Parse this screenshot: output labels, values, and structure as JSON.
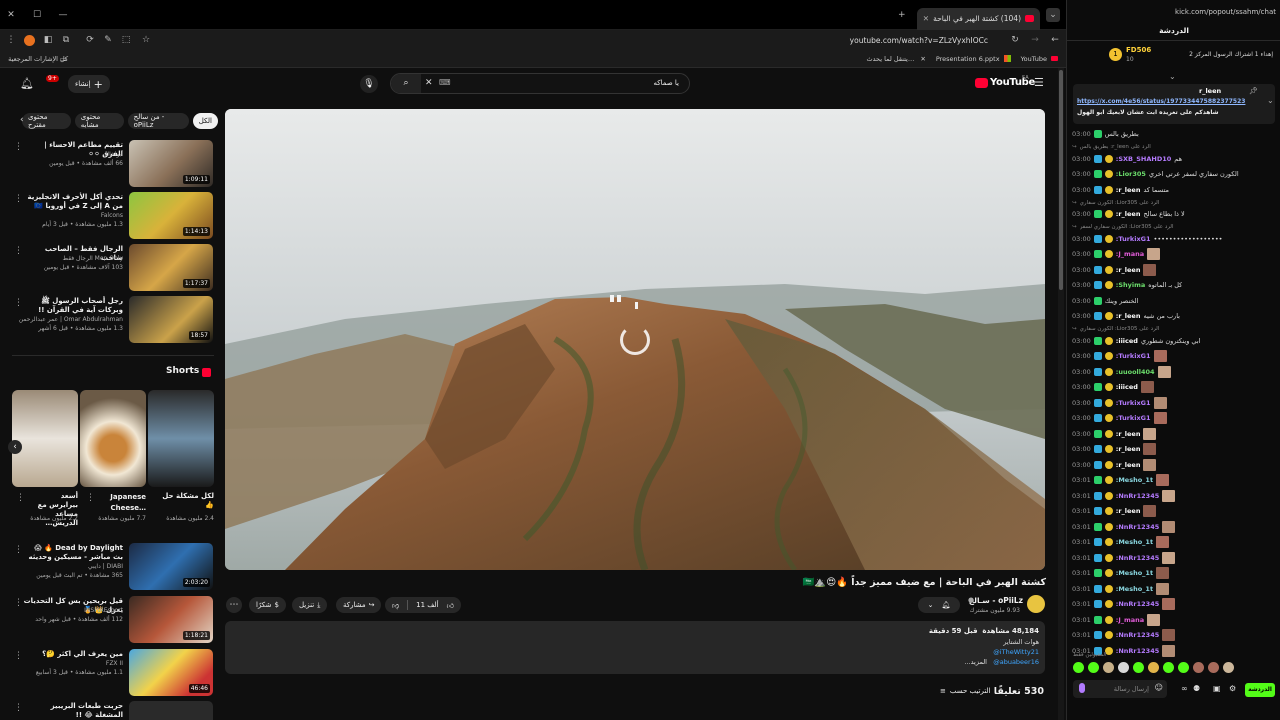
{
  "browser": {
    "tabs": [
      {
        "label": "(104) كشتة الهبر في الباحة",
        "active": true
      }
    ],
    "url": "youtube.com/watch?v=ZLzVyxhIOCc",
    "bookmarks": {
      "all": "كل الإشارات المرجعية",
      "items": [
        "YouTube",
        "Presentation 6.pptx",
        "يتنقل لما يحدث…",
        "X"
      ]
    }
  },
  "youtube": {
    "logo": "YouTube",
    "region": "SA",
    "search_query": "يا صماكه",
    "create_label": "إنشاء",
    "notif_count": "9+",
    "filter_chips": [
      "الكل",
      "من سالح - oPiiLz",
      "محتوى مشابه",
      "محتوى مقترح"
    ],
    "video": {
      "title": "كشتة الهبر في الباحة | مع ضيف مميز جداً 🔥😍⛰️🇸🇦",
      "channel": "oPiiLz - سـالح",
      "subscribers": "9.93 مليون مشترك",
      "likes": "11 ألف",
      "actions": {
        "share": "مشاركة",
        "download": "تنزيل",
        "clip": "شكرًا"
      },
      "description": {
        "views": "48,184 مشاهدة",
        "date": "قبل 59 دقيقة",
        "line1": "هوات الشتاير",
        "link1": "@iTheWitty21",
        "link2": "@abuabeer16",
        "more": "...المزيد"
      },
      "comments_count": "530 تعليقًا",
      "sort_label": "الترتيب حسب"
    },
    "recommendations": [
      {
        "title": "تقييم مطاعم الاحساء | الفرق ⚪⚪",
        "channel": "أبو خالد",
        "meta": "66 ألف مشاهدة • قبل يومين",
        "duration": "1:09:11"
      },
      {
        "title": "تحدي أكل الأحرف الانجليزية من A إلى Z في أوروبا 🇪🇺",
        "channel": "Falcons",
        "meta": "1.3 مليون مشاهدة • قبل 3 أيام",
        "duration": "1:14:13"
      },
      {
        "title": "الرجال فقط – الصاحب ساحب",
        "channel": "Men Only الرجال فقط",
        "meta": "103 آلاف مشاهدة • قبل يومين",
        "duration": "1:17:37"
      },
      {
        "title": "رجل أصحاب الرسول ﷺ وبركات آية في القرآن !!",
        "channel": "Omar Abdulrahman | عمر عبدالرحمن",
        "meta": "1.3 مليون مشاهدة • قبل 6 أشهر",
        "duration": "18:57"
      }
    ],
    "shorts_header": "Shorts",
    "shorts": [
      {
        "title": "أسعد بيرايرس مع مساعد الدريس…",
        "views": "2.2 مليون مشاهدة"
      },
      {
        "title": "Japanese Cheese…",
        "views": "7.7 مليون مشاهدة"
      },
      {
        "title": "لكل مشكلة حل 👍",
        "views": "2.4 مليون مشاهدة"
      }
    ],
    "recommendations2": [
      {
        "title": "Dead by Daylight 🔥 😱 بث مباشر - مسيكين وحديثه",
        "channel": "DIABI | دايبي",
        "meta": "365 مشاهدة • تم البث قبل يومين",
        "duration": "2:03:20"
      },
      {
        "title": "قيل بريحين بس كل التحديات يعزل 👑 🏅",
        "channel": "INSPIREsport",
        "meta": "112 ألف مشاهدة • قبل شهر واحد",
        "duration": "1:18:21"
      },
      {
        "title": "مين يعرف الي اكثر 🤔؟",
        "channel": "FZX II",
        "meta": "1.1 مليون مشاهدة • قبل 3 أسابيع",
        "duration": "46:46"
      },
      {
        "title": "حربت طبعات البريبيز المشغلة 😂 !!",
        "channel": "",
        "meta": "",
        "duration": ""
      }
    ]
  },
  "kick": {
    "url": "kick.com/popout/ssahm/chat",
    "header": "الدردشة",
    "pinned": {
      "user": "FD506",
      "text": "إهداء 1 اشتراك الرسول المركز 2",
      "count": "10"
    },
    "pinned_msg": {
      "user": "r_leen",
      "link": "https://x.com/4e56/status/1977334475882377523",
      "text": "شاهدكم على تغريده ابت عشان لابعيك ابو الهول"
    },
    "messages": [
      {
        "time": "03:00",
        "user": "",
        "text": "بطريق بالس",
        "color": "#dddddd"
      },
      {
        "time": "",
        "user": "",
        "text": "الرد على r_leen: بطريق بالس",
        "color": "#888888"
      },
      {
        "time": "03:00",
        "user": "SXB_SHAHD10:",
        "text": "هم",
        "color": "#b57bff"
      },
      {
        "time": "03:00",
        "user": "Lior305:",
        "text": "الكورن سفاري لسفر عرتي اخري",
        "color": "#6cde6c"
      },
      {
        "time": "03:00",
        "user": "r_leen:",
        "text": "متسما كد",
        "color": "#ffffff"
      },
      {
        "time": "",
        "user": "",
        "text": "الرد على Lior305: الكورن سفاري",
        "color": "#888888"
      },
      {
        "time": "03:00",
        "user": "r_leen:",
        "text": "لا ذا بطاع سالح",
        "color": "#ffffff"
      },
      {
        "time": "",
        "user": "",
        "text": "الرد على Lior305: الكورن سفاري لسفر",
        "color": "#888888"
      },
      {
        "time": "03:00",
        "user": "TurkixG1:",
        "text": "••••••••••••••••••",
        "color": "#b57bff"
      },
      {
        "time": "03:00",
        "user": "J_mana:",
        "text": "",
        "color": "#e05bd6"
      },
      {
        "time": "03:00",
        "user": "r_leen:",
        "text": "",
        "color": "#ffffff"
      },
      {
        "time": "03:00",
        "user": "Shyima:",
        "text": "كل بـ الماتوه",
        "color": "#6cde6c"
      },
      {
        "time": "03:00",
        "user": "",
        "text": "الخنصر وينك",
        "color": "#dddddd"
      },
      {
        "time": "03:00",
        "user": "r_leen:",
        "text": "بارب من شيه",
        "color": "#ffffff"
      },
      {
        "time": "",
        "user": "",
        "text": "الرد على Lior305: الكورن سفاري",
        "color": "#888888"
      },
      {
        "time": "03:00",
        "user": "iiiced:",
        "text": "ابي وينكترون شطوري",
        "color": "#ffffff"
      },
      {
        "time": "03:00",
        "user": "TurkixG1:",
        "text": "",
        "color": "#b57bff"
      },
      {
        "time": "03:00",
        "user": "uuooll404:",
        "text": "",
        "color": "#6cde6c"
      },
      {
        "time": "03:00",
        "user": "iiiced:",
        "text": "",
        "color": "#ffffff"
      },
      {
        "time": "03:00",
        "user": "TurkixG1:",
        "text": "",
        "color": "#b57bff"
      },
      {
        "time": "03:00",
        "user": "TurkixG1:",
        "text": "",
        "color": "#b57bff"
      },
      {
        "time": "03:00",
        "user": "r_leen:",
        "text": "",
        "color": "#ffffff"
      },
      {
        "time": "03:00",
        "user": "r_leen:",
        "text": "",
        "color": "#ffffff"
      },
      {
        "time": "03:00",
        "user": "r_leen:",
        "text": "",
        "color": "#ffffff"
      },
      {
        "time": "03:01",
        "user": "Mesho_1t:",
        "text": "",
        "color": "#8ad7e0"
      },
      {
        "time": "03:01",
        "user": "NnRr12345:",
        "text": "",
        "color": "#b57bff"
      },
      {
        "time": "03:01",
        "user": "r_leen:",
        "text": "",
        "color": "#ffffff"
      },
      {
        "time": "03:01",
        "user": "NnRr12345:",
        "text": "",
        "color": "#b57bff"
      },
      {
        "time": "03:01",
        "user": "Mesho_1t:",
        "text": "",
        "color": "#8ad7e0"
      },
      {
        "time": "03:01",
        "user": "NnRr12345:",
        "text": "",
        "color": "#b57bff"
      },
      {
        "time": "03:01",
        "user": "Mesho_1t:",
        "text": "",
        "color": "#8ad7e0"
      },
      {
        "time": "03:01",
        "user": "Mesho_1t:",
        "text": "",
        "color": "#8ad7e0"
      },
      {
        "time": "03:01",
        "user": "NnRr12345:",
        "text": "",
        "color": "#b57bff"
      },
      {
        "time": "03:01",
        "user": "J_mana:",
        "text": "",
        "color": "#e05bd6"
      },
      {
        "time": "03:01",
        "user": "NnRr12345:",
        "text": "",
        "color": "#b57bff"
      },
      {
        "time": "03:01",
        "user": "NnRr12345:",
        "text": "",
        "color": "#b57bff"
      }
    ],
    "emote_label": "المقبولين فقط",
    "input_placeholder": "إرسال رسالة",
    "send_label": "الدردشة"
  },
  "colors": {
    "yt_red": "#ff0033",
    "kick_green": "#53fc18",
    "bg": "#0f0f0f"
  }
}
